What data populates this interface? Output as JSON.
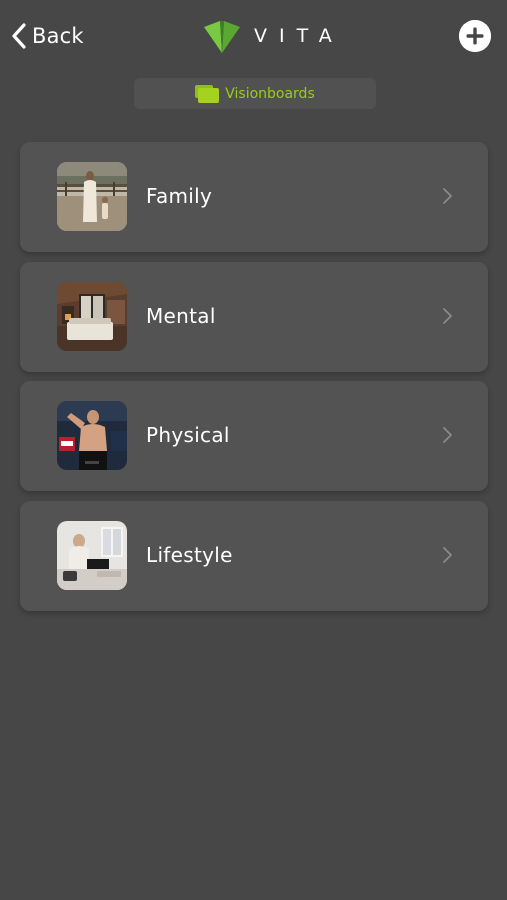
{
  "header": {
    "back_label": "Back",
    "brand_name": "VITA",
    "brand_color": "#7ac943",
    "add_icon": "plus-circle-icon"
  },
  "section": {
    "label": "Visionboards",
    "icon": "folder-stack-icon",
    "accent_color": "#9acd1a"
  },
  "boards": [
    {
      "title": "Family",
      "thumbnail": "family-photo"
    },
    {
      "title": "Mental",
      "thumbnail": "bedroom-photo"
    },
    {
      "title": "Physical",
      "thumbnail": "fighter-photo"
    },
    {
      "title": "Lifestyle",
      "thumbnail": "workspace-photo"
    }
  ],
  "colors": {
    "background": "#474747",
    "card": "#535353",
    "chevron": "#8a8a8a"
  }
}
